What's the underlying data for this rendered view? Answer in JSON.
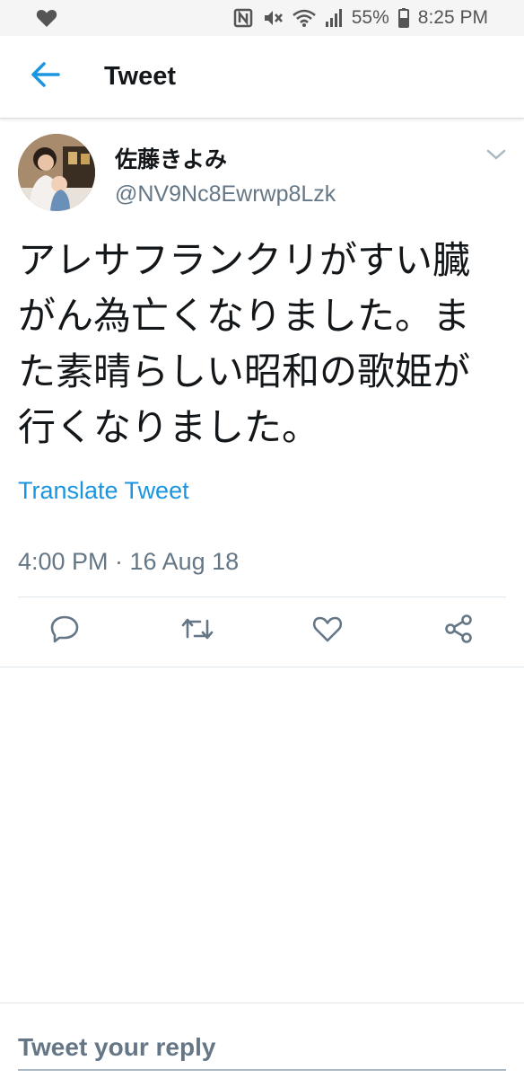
{
  "status_bar": {
    "icons": [
      "heart-icon",
      "nfc-icon",
      "mute-icon",
      "wifi-icon",
      "signal-icon",
      "battery-icon"
    ],
    "battery": "55%",
    "time": "8:25 PM"
  },
  "header": {
    "title": "Tweet",
    "back_icon": "arrow-left-icon"
  },
  "tweet": {
    "display_name": "佐藤きよみ",
    "handle": "@NV9Nc8Ewrwp8Lzk",
    "text": "アレサフランクリがすい臓\nがん為亡くなりました。ま\nた素晴らしい昭和の歌姫が\n行くなりました。",
    "translate_label": "Translate Tweet",
    "timestamp": "4:00 PM · 16 Aug 18",
    "actions": [
      "reply-icon",
      "retweet-icon",
      "like-icon",
      "share-icon"
    ]
  },
  "reply": {
    "placeholder": "Tweet your reply"
  },
  "colors": {
    "accent": "#1b95e0",
    "text": "#14171a",
    "secondary": "#657786",
    "divider": "#e1e8ed"
  }
}
